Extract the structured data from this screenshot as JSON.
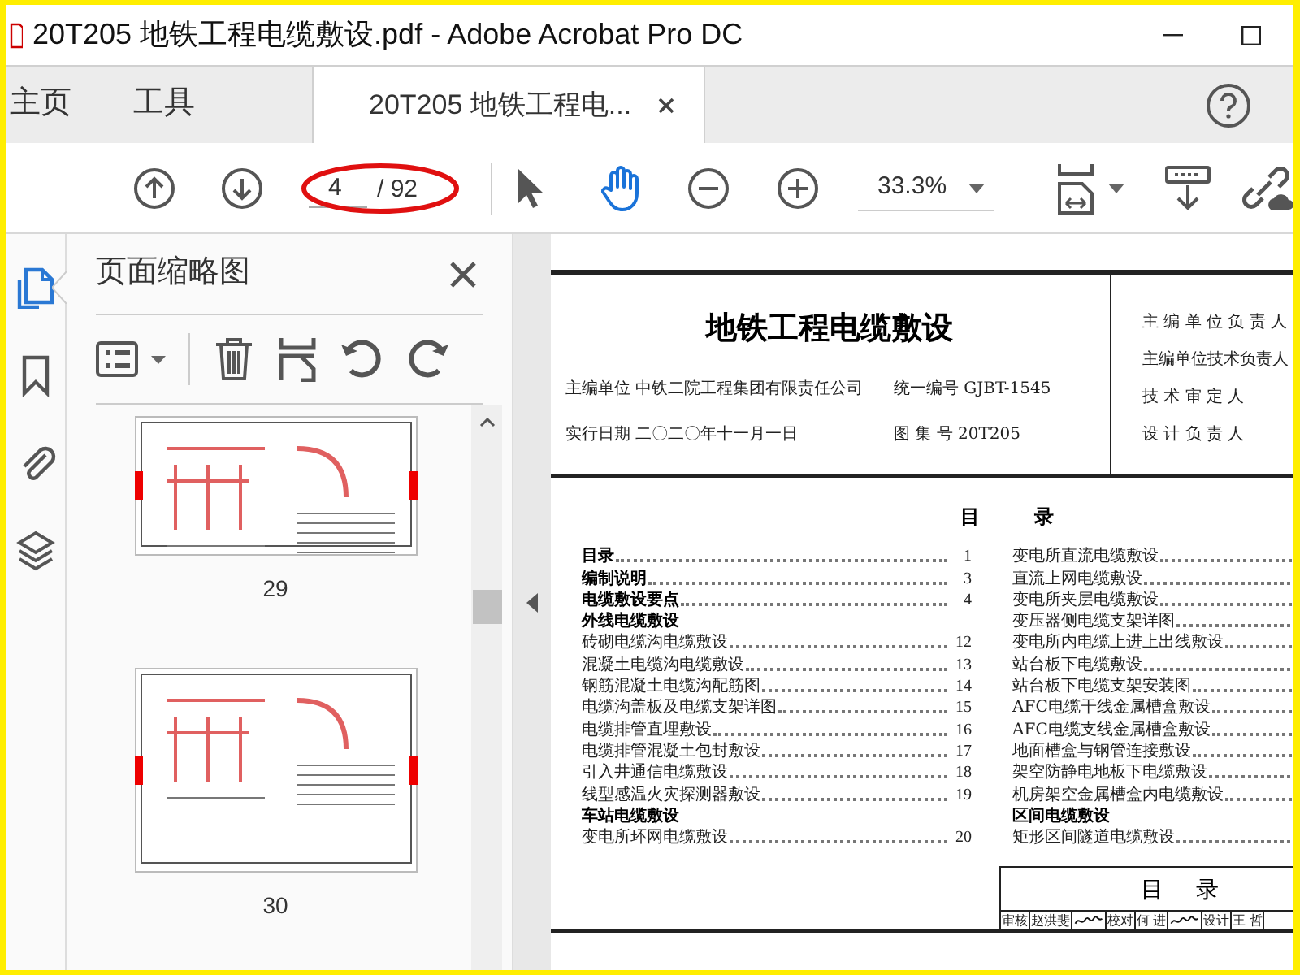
{
  "window": {
    "title": "20T205 地铁工程电缆敷设.pdf - Adobe Acrobat Pro DC"
  },
  "tabs": [
    {
      "label": "主页",
      "selected": false,
      "kind": "nav"
    },
    {
      "label": "工具",
      "selected": false,
      "kind": "nav"
    },
    {
      "label": "20T205 地铁工程电...",
      "selected": true,
      "kind": "document"
    }
  ],
  "toolbar": {
    "page_value": "4",
    "page_total": "/ 92",
    "zoom": "33.3%",
    "tools": [
      {
        "kind": "pointer",
        "selected": false
      },
      {
        "kind": "hand",
        "selected": true
      }
    ]
  },
  "rail": [
    {
      "kind": "pages",
      "selected": true
    },
    {
      "kind": "bookmark",
      "selected": false
    },
    {
      "kind": "attachment",
      "selected": false
    },
    {
      "kind": "layers",
      "selected": false
    }
  ],
  "thumbnails_panel": {
    "title": "页面缩略图",
    "pages": [
      {
        "label": "29"
      },
      {
        "label": "30"
      }
    ]
  },
  "document": {
    "title": "地铁工程电缆敷设",
    "info": [
      {
        "label": "主编单位 中铁二院工程集团有限责任公司",
        "value": "统一编号 GJBT-1545"
      },
      {
        "label": "实行日期 二〇二〇年十一月一日",
        "value": "图 集 号 20T205"
      }
    ],
    "roles": [
      "主 编 单 位 负 责 人",
      "主编单位技术负责人",
      "技 术 审 定 人",
      "设 计 负 责 人"
    ],
    "toc_heading": "目 录",
    "toc_left": [
      {
        "kind": "bold",
        "text": "目录",
        "page": "1"
      },
      {
        "kind": "bold",
        "text": "编制说明",
        "page": "3"
      },
      {
        "kind": "bold",
        "text": "电缆敷设要点",
        "page": "4"
      },
      {
        "kind": "section",
        "text": "外线电缆敷设"
      },
      {
        "kind": "entry",
        "text": "砖砌电缆沟电缆敷设",
        "page": "12"
      },
      {
        "kind": "entry",
        "text": "混凝土电缆沟电缆敷设",
        "page": "13"
      },
      {
        "kind": "entry",
        "text": "钢筋混凝土电缆沟配筋图",
        "page": "14"
      },
      {
        "kind": "entry",
        "text": "电缆沟盖板及电缆支架详图",
        "page": "15"
      },
      {
        "kind": "entry",
        "text": "电缆排管直埋敷设",
        "page": "16"
      },
      {
        "kind": "entry",
        "text": "电缆排管混凝土包封敷设",
        "page": "17"
      },
      {
        "kind": "entry",
        "text": "引入井通信电缆敷设",
        "page": "18"
      },
      {
        "kind": "entry",
        "text": "线型感温火灾探测器敷设",
        "page": "19"
      },
      {
        "kind": "section",
        "text": "车站电缆敷设"
      },
      {
        "kind": "entry",
        "text": "变电所环网电缆敷设",
        "page": "20"
      }
    ],
    "toc_right": [
      {
        "kind": "entry",
        "text": "变电所直流电缆敷设"
      },
      {
        "kind": "entry",
        "text": "直流上网电缆敷设"
      },
      {
        "kind": "entry",
        "text": "变电所夹层电缆敷设"
      },
      {
        "kind": "entry",
        "text": "变压器侧电缆支架详图"
      },
      {
        "kind": "entry",
        "text": "变电所内电缆上进上出线敷设"
      },
      {
        "kind": "entry",
        "text": "站台板下电缆敷设"
      },
      {
        "kind": "entry",
        "text": "站台板下电缆支架安装图"
      },
      {
        "kind": "entry",
        "text": "AFC电缆干线金属槽盒敷设"
      },
      {
        "kind": "entry",
        "text": "AFC电缆支线金属槽盒敷设"
      },
      {
        "kind": "entry",
        "text": "地面槽盒与钢管连接敷设"
      },
      {
        "kind": "entry",
        "text": "架空防静电地板下电缆敷设"
      },
      {
        "kind": "entry",
        "text": "机房架空金属槽盒内电缆敷设"
      },
      {
        "kind": "section",
        "text": "区间电缆敷设"
      },
      {
        "kind": "entry",
        "text": "矩形区间隧道电缆敷设"
      }
    ],
    "title_block": {
      "heading": "目 录",
      "cells": [
        {
          "kind": "text",
          "text": "审核"
        },
        {
          "kind": "text",
          "text": "赵洪斐"
        },
        {
          "kind": "signature"
        },
        {
          "kind": "text",
          "text": "校对"
        },
        {
          "kind": "text",
          "text": "何 进"
        },
        {
          "kind": "signature"
        },
        {
          "kind": "text",
          "text": "设计"
        },
        {
          "kind": "text",
          "text": "王 哲"
        }
      ]
    }
  }
}
